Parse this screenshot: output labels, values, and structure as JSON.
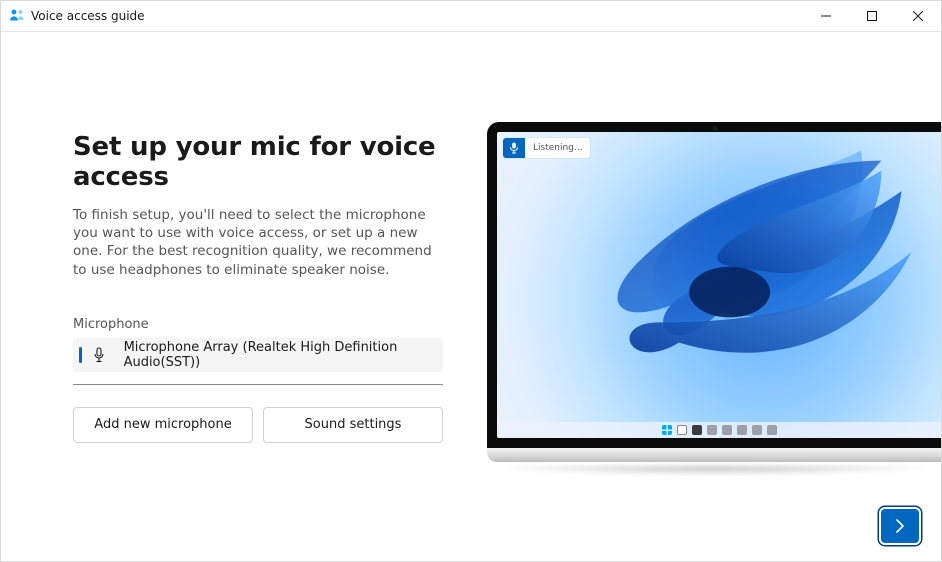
{
  "window": {
    "title": "Voice access guide"
  },
  "page": {
    "heading": "Set up your mic for voice access",
    "description": "To finish setup, you'll need to select the microphone you want to use with voice access, or set up a new one. For the best recognition quality, we recommend to use headphones to eliminate speaker noise."
  },
  "mic": {
    "label": "Microphone",
    "selected": "Microphone Array (Realtek High Definition Audio(SST))"
  },
  "buttons": {
    "add_mic": "Add new microphone",
    "sound_settings": "Sound settings"
  },
  "illustration": {
    "voice_access_status": "Listening..."
  },
  "colors": {
    "accent": "#0067c0"
  }
}
